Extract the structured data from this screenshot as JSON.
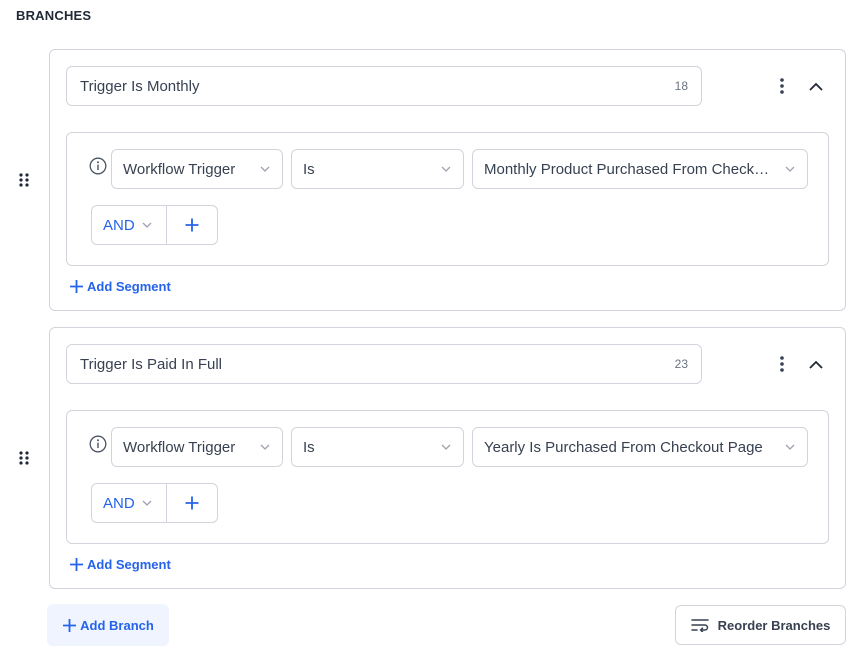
{
  "section": {
    "title": "BRANCHES"
  },
  "branches": [
    {
      "name": "Trigger Is Monthly",
      "char_count": "18",
      "segment": {
        "field": "Workflow Trigger",
        "operator": "Is",
        "value": "Monthly Product Purchased From Checkout Page",
        "logic": "AND"
      },
      "add_segment_label": "Add Segment"
    },
    {
      "name": "Trigger Is Paid In Full",
      "char_count": "23",
      "segment": {
        "field": "Workflow Trigger",
        "operator": "Is",
        "value": "Yearly Is Purchased From Checkout Page",
        "logic": "AND"
      },
      "add_segment_label": "Add Segment"
    }
  ],
  "footer": {
    "add_branch_label": "Add Branch",
    "reorder_label": "Reorder Branches"
  },
  "colors": {
    "accent": "#2563eb",
    "border": "#d1d5db",
    "add_branch_bg": "#eff4ff"
  },
  "icons": [
    "drag-handle-icon",
    "kebab-menu-icon",
    "chevron-up-icon",
    "info-icon",
    "chevron-down-icon",
    "plus-icon",
    "reorder-icon"
  ]
}
